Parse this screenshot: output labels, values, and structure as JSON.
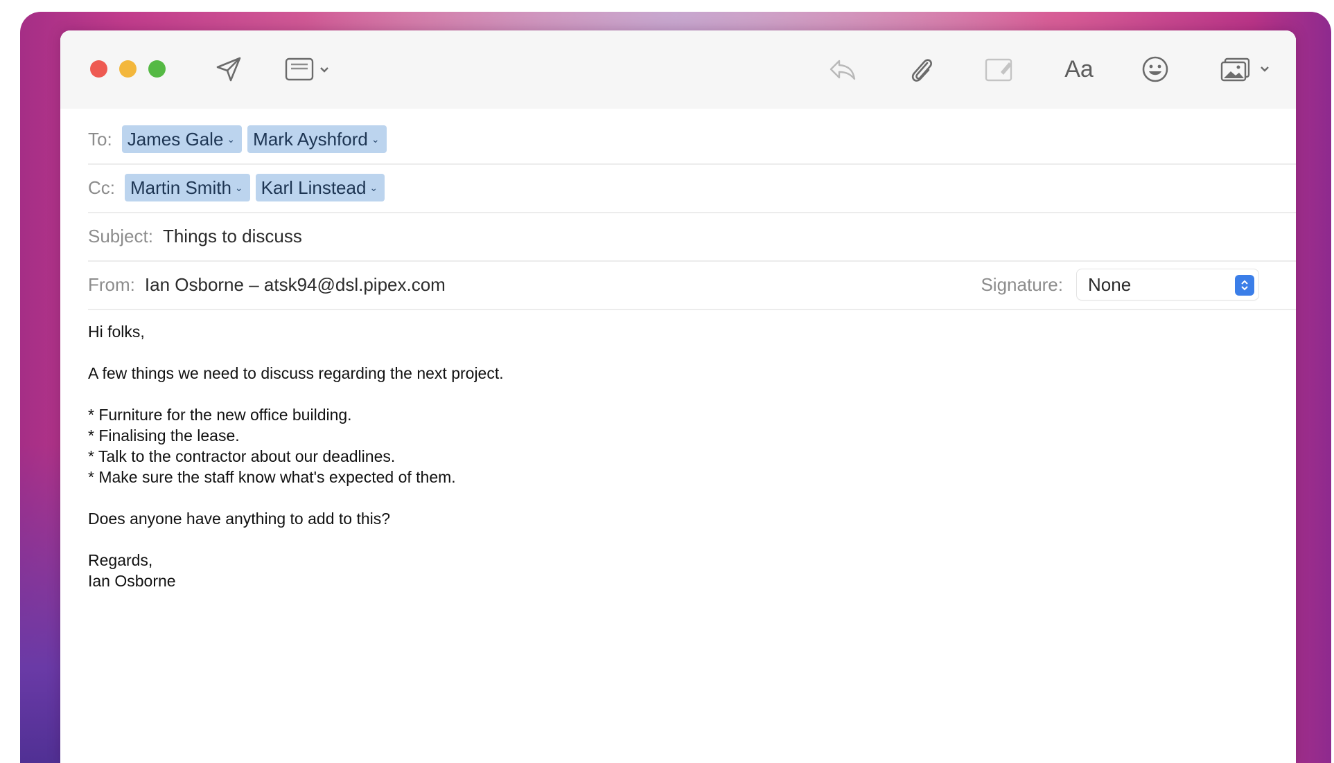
{
  "toolbar": {
    "font_button_label": "Aa",
    "icons": [
      "send-icon",
      "header-fields-icon",
      "reply-icon",
      "attachment-icon",
      "markup-icon",
      "emoji-icon",
      "photo-browser-icon"
    ]
  },
  "to": {
    "label": "To:",
    "recipients": [
      "James Gale",
      "Mark Ayshford"
    ]
  },
  "cc": {
    "label": "Cc:",
    "recipients": [
      "Martin Smith",
      "Karl Linstead"
    ]
  },
  "subject": {
    "label": "Subject:",
    "value": "Things to discuss"
  },
  "from": {
    "label": "From:",
    "value": "Ian Osborne – atsk94@dsl.pipex.com"
  },
  "signature": {
    "label": "Signature:",
    "value": "None"
  },
  "body": {
    "greeting": "Hi folks,",
    "intro": "A few things we need to discuss regarding the next project.",
    "items": [
      "* Furniture for the new office building.",
      "* Finalising the lease.",
      "* Talk to the contractor about our deadlines.",
      "* Make sure the staff know what's expected of them."
    ],
    "question": "Does anyone have anything to add to this?",
    "closing": "Regards,",
    "sender_name": "Ian Osborne"
  },
  "colors": {
    "chip_background": "#bcd4ee",
    "close": "#ee5a52",
    "minimize": "#f3b73c",
    "zoom": "#55b944",
    "accent": "#3b7ee8"
  }
}
